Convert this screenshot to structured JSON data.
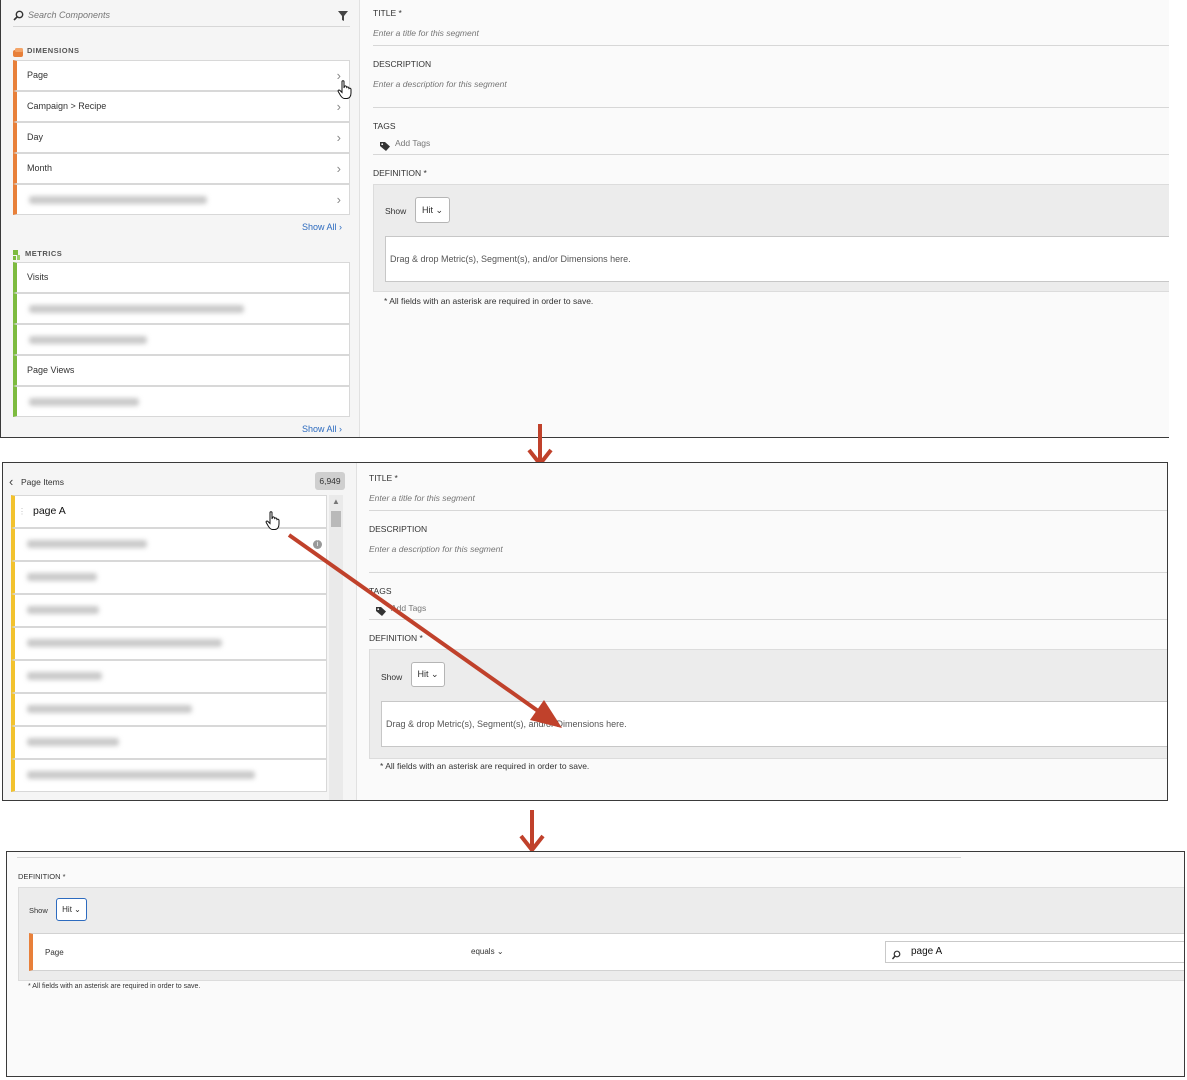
{
  "colors": {
    "dimension": "#e8803a",
    "metric": "#7dbb3f",
    "page_item": "#f2c22e",
    "link": "#2d6bbf",
    "arrow": "#c0412b"
  },
  "step1": {
    "search_placeholder": "Search Components",
    "dimensions": {
      "header": "DIMENSIONS",
      "items": [
        "Page",
        "Campaign > Recipe",
        "Day",
        "Month"
      ],
      "show_all": "Show All"
    },
    "metrics": {
      "header": "METRICS",
      "items": [
        "Visits",
        "",
        "",
        "Page Views",
        ""
      ],
      "show_all": "Show All"
    },
    "form": {
      "title_label": "TITLE *",
      "title_placeholder": "Enter a title for this segment",
      "description_label": "DESCRIPTION",
      "description_placeholder": "Enter a description for this segment",
      "tags_label": "TAGS",
      "add_tags": "Add Tags",
      "definition_label": "DEFINITION *",
      "show_label": "Show",
      "show_value": "Hit",
      "drop_hint": "Drag & drop Metric(s), Segment(s), and/or Dimensions here.",
      "required_note": "* All fields with an asterisk are required in order to save."
    }
  },
  "step2": {
    "back_title": "Page Items",
    "count": "6,949",
    "first_item": "page A",
    "form": {
      "title_label": "TITLE *",
      "title_placeholder": "Enter a title for this segment",
      "description_label": "DESCRIPTION",
      "description_placeholder": "Enter a description for this segment",
      "tags_label": "TAGS",
      "add_tags": "Add Tags",
      "definition_label": "DEFINITION *",
      "show_label": "Show",
      "show_value": "Hit",
      "drop_hint": "Drag & drop Metric(s), Segment(s), and/or Dimensions here.",
      "required_note": "* All fields with an asterisk are required in order to save."
    }
  },
  "step3": {
    "definition_label": "DEFINITION *",
    "show_label": "Show",
    "show_value": "Hit",
    "rule_dimension": "Page",
    "rule_operator": "equals",
    "rule_value": "page A",
    "required_note": "* All fields with an asterisk are required in order to save."
  }
}
